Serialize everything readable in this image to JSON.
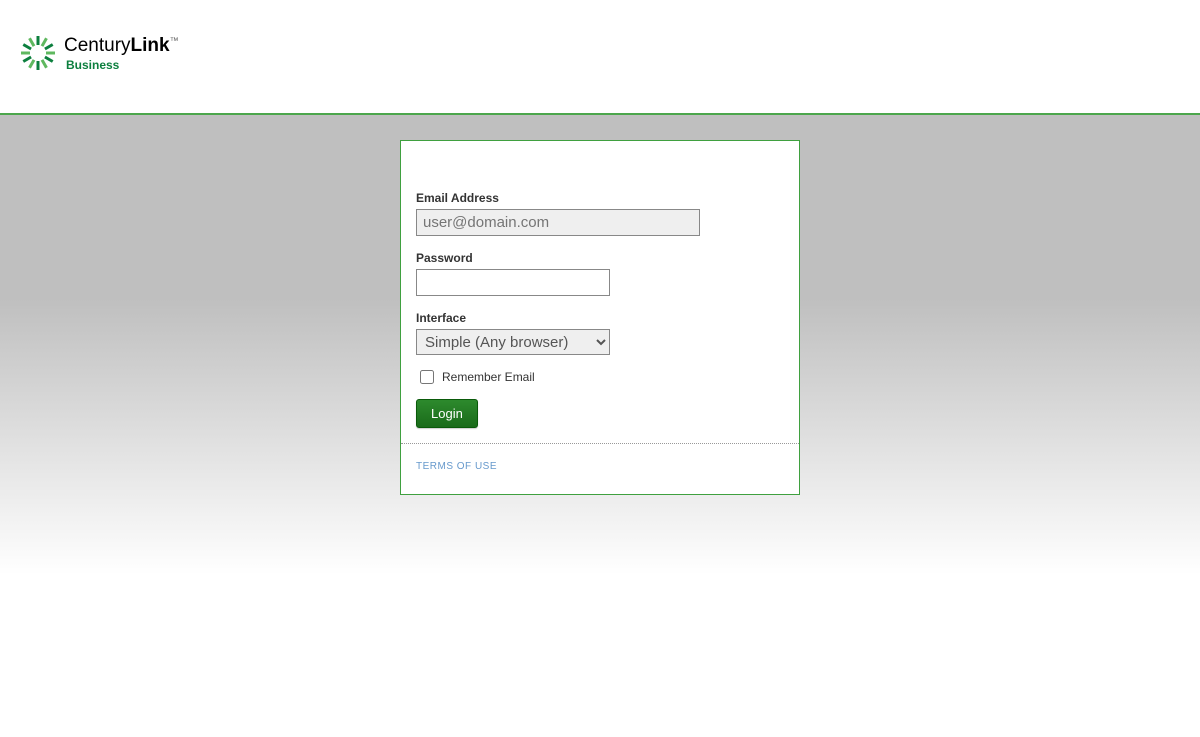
{
  "brand": {
    "name_part1": "Century",
    "name_part2": "Link",
    "tm": "™",
    "sub": "Business"
  },
  "form": {
    "email_label": "Email Address",
    "email_placeholder": "user@domain.com",
    "email_value": "",
    "password_label": "Password",
    "password_value": "",
    "interface_label": "Interface",
    "interface_selected": "Simple (Any browser)",
    "remember_label": "Remember Email",
    "login_button": "Login"
  },
  "footer": {
    "terms_label": "TERMS OF USE"
  }
}
